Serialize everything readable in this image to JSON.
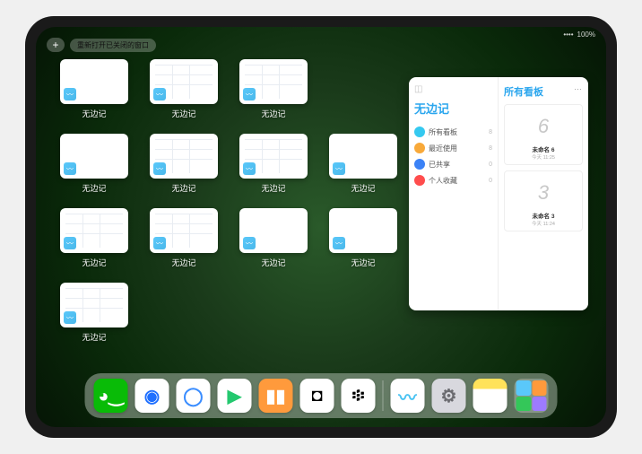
{
  "status": {
    "wifi": "◉",
    "battery": "100%",
    "signal": "••••"
  },
  "top": {
    "plus": "+",
    "reopen_label": "重新打开已关闭的窗口"
  },
  "expose": {
    "app_label": "无边记",
    "items": [
      {
        "content": false
      },
      {
        "content": true
      },
      {
        "content": true
      },
      {
        "content": false
      },
      {
        "content": true
      },
      {
        "content": true
      },
      {
        "content": false
      },
      {
        "content": true
      },
      {
        "content": true
      },
      {
        "content": false
      },
      {
        "content": false
      },
      {
        "content": true
      }
    ]
  },
  "panel": {
    "left_title": "无边记",
    "more": "…",
    "rows": [
      {
        "icon_color": "#35c9f0",
        "label": "所有看板",
        "count": "8"
      },
      {
        "icon_color": "#f8a93a",
        "label": "最近使用",
        "count": "8"
      },
      {
        "icon_color": "#3b82f6",
        "label": "已共享",
        "count": "0"
      },
      {
        "icon_color": "#ff4d4d",
        "label": "个人收藏",
        "count": "0"
      }
    ],
    "right_title": "所有看板",
    "boards": [
      {
        "glyph": "6",
        "title": "未命名 6",
        "date": "今天 11:25"
      },
      {
        "glyph": "3",
        "title": "未命名 3",
        "date": "今天 11:24"
      }
    ]
  },
  "dock": {
    "apps": [
      {
        "name": "wechat",
        "bg": "#09bb07",
        "glyph": "◕‿",
        "fg": "#fff"
      },
      {
        "name": "qq",
        "bg": "#ffffff",
        "glyph": "◉",
        "fg": "#1e6fff"
      },
      {
        "name": "quark",
        "bg": "#ffffff",
        "glyph": "◯",
        "fg": "#3a8dff"
      },
      {
        "name": "video",
        "bg": "#ffffff",
        "glyph": "▶",
        "fg": "#24c86f"
      },
      {
        "name": "books",
        "bg": "#ff9a3c",
        "glyph": "▮▮",
        "fg": "#fff"
      },
      {
        "name": "blackwhite",
        "bg": "#ffffff",
        "glyph": "◘",
        "fg": "#000"
      },
      {
        "name": "dots",
        "bg": "#ffffff",
        "glyph": "፨",
        "fg": "#000"
      }
    ],
    "recent": [
      {
        "name": "freeform",
        "bg": "#ffffff",
        "glyph": "〰",
        "fg": "#4ac3f2"
      },
      {
        "name": "settings",
        "bg": "#d8d8de",
        "glyph": "⚙",
        "fg": "#6b6b70"
      },
      {
        "name": "notes",
        "bg": "linear-gradient(#ffe25a 30%, #ffffff 30%)",
        "glyph": "",
        "fg": "#333"
      }
    ],
    "stack": {
      "cells": [
        "#5ac8fa",
        "#ff9a3c",
        "#34c759",
        "#9d7bff"
      ]
    }
  }
}
